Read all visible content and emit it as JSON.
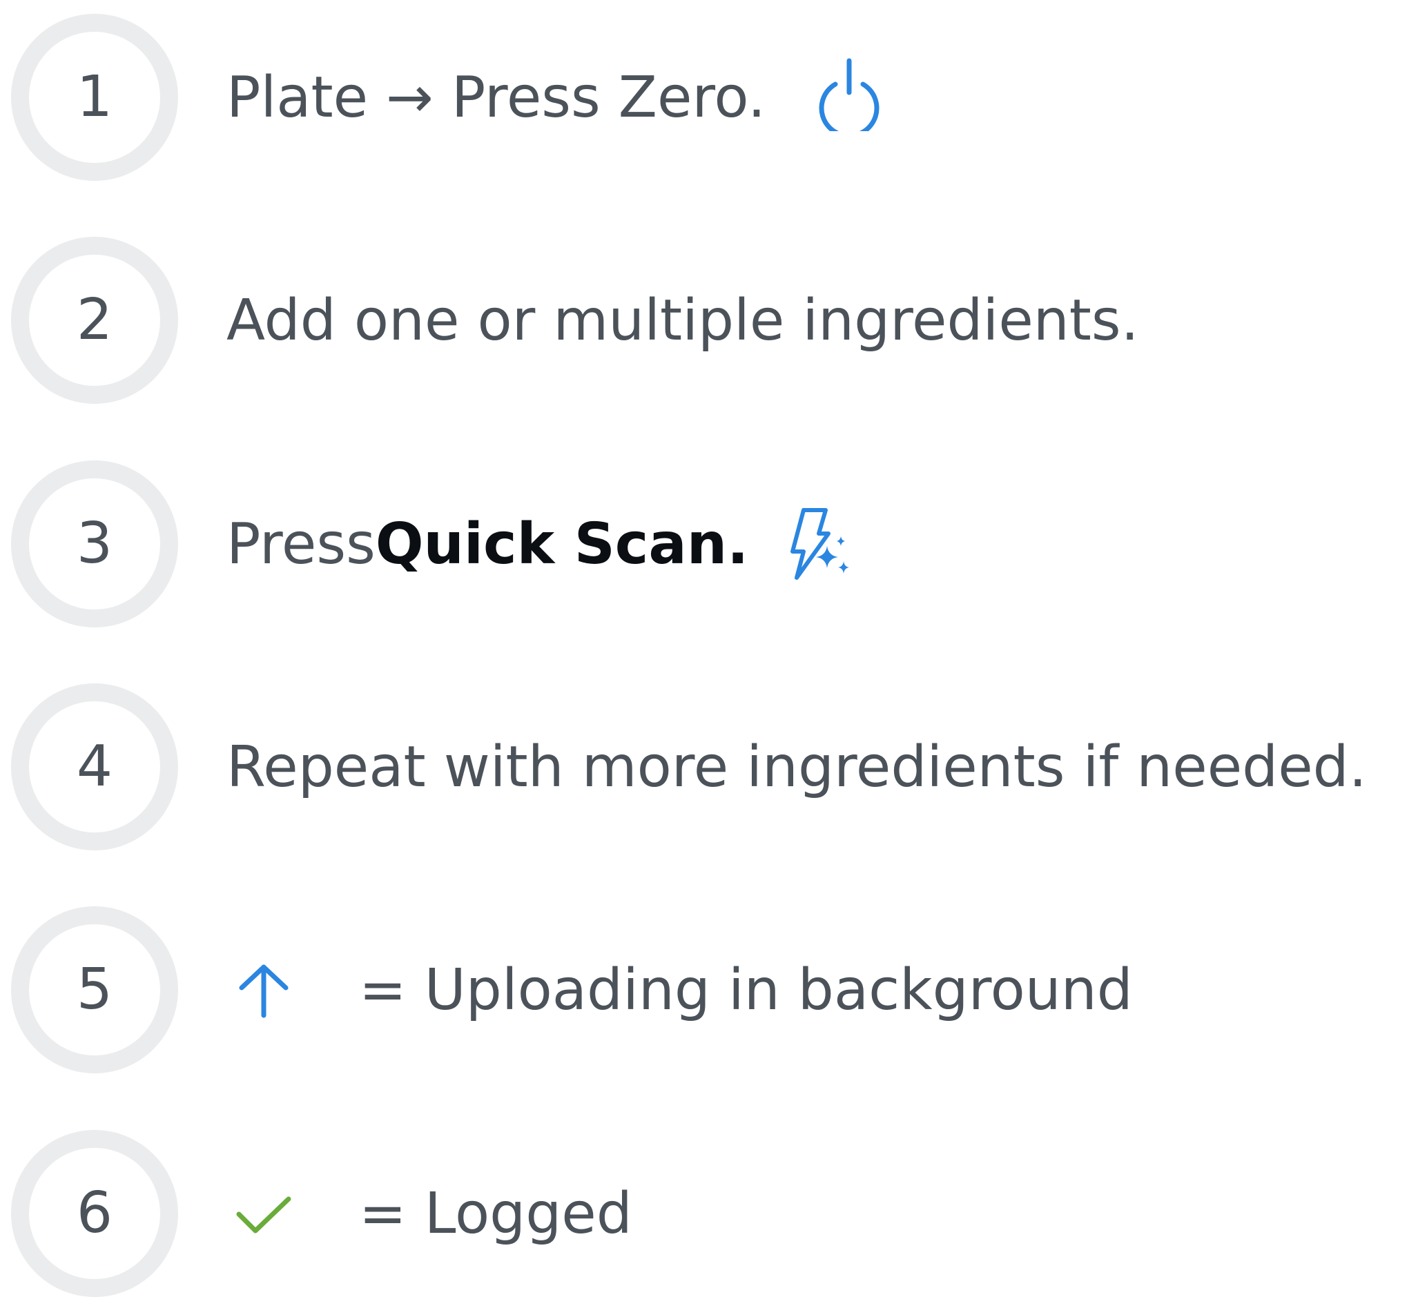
{
  "colors": {
    "accent_blue": "#2a86e0",
    "success_green": "#6aac3a",
    "text": "#4b5259",
    "text_strong": "#0b0f14",
    "circle": "#ebecee"
  },
  "steps": [
    {
      "number": "1",
      "text": "Plate → Press Zero.",
      "icon": "power-icon"
    },
    {
      "number": "2",
      "text": "Add one or multiple ingredients."
    },
    {
      "number": "3",
      "text_prefix": "Press ",
      "text_bold": "Quick Scan.",
      "icon": "quick-scan-bolt-sparkle-icon"
    },
    {
      "number": "4",
      "text": "Repeat with more ingredients if needed."
    },
    {
      "number": "5",
      "icon": "upload-arrow-icon",
      "text": "= Uploading in background"
    },
    {
      "number": "6",
      "icon": "checkmark-icon",
      "text": "= Logged"
    }
  ]
}
